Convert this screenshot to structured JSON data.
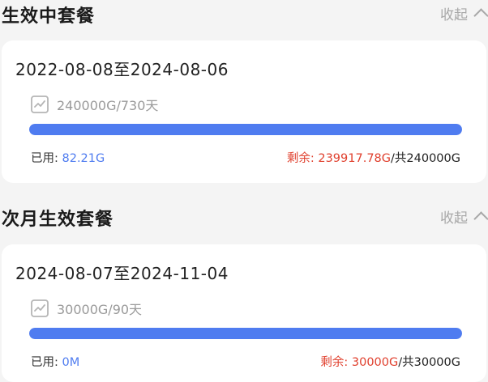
{
  "active": {
    "title": "生效中套餐",
    "collapse_label": "收起",
    "period": "2022-08-08至2024-08-06",
    "quota": "240000G/730天",
    "usage_fraction": 1.0,
    "used_label": "已用: ",
    "used_value": "82.21G",
    "remain_label": "剩余: 239917.78G",
    "total_label": "/共240000G",
    "colors": {
      "accent": "#4f7cf0",
      "danger": "#e0402e"
    }
  },
  "next": {
    "title": "次月生效套餐",
    "collapse_label": "收起",
    "period": "2024-08-07至2024-11-04",
    "quota": "30000G/90天",
    "usage_fraction": 1.0,
    "used_label": "已用: ",
    "used_value": "0M",
    "remain_label": "剩余: 30000G",
    "total_label": "/共30000G"
  }
}
